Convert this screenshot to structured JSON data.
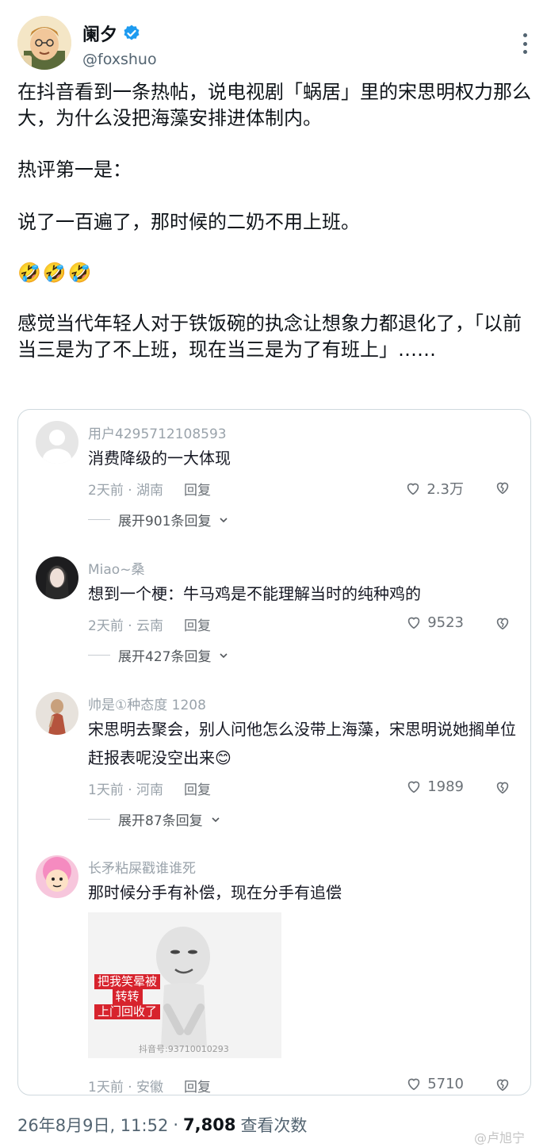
{
  "author": {
    "name": "阑夕",
    "handle": "@foxshuo",
    "verified_color": "#1d9bf0"
  },
  "post": {
    "para1": "在抖音看到一条热帖，说电视剧「蜗居」里的宋思明权力那么大，为什么没把海藻安排进体制内。",
    "para2": "热评第一是：",
    "para3": "说了一百遍了，那时候的二奶不用上班。",
    "emoji": [
      "🤣",
      "🤣",
      "🤣"
    ],
    "para5": "感觉当代年轻人对于铁饭碗的执念让想象力都退化了，「以前当三是为了不上班，现在当三是为了有班上」……"
  },
  "comments": [
    {
      "user": "用户4295712108593",
      "text": "消费降级的一大体现",
      "time_loc": "2天前 · 湖南",
      "reply": "回复",
      "likes": "2.3万",
      "expand": "展开901条回复"
    },
    {
      "user": "Miao~桑",
      "text": "想到一个梗：牛马鸡是不能理解当时的纯种鸡的",
      "time_loc": "2天前 · 云南",
      "reply": "回复",
      "likes": "9523",
      "expand": "展开427条回复"
    },
    {
      "user": "帅是①种态度 1208",
      "text": "宋思明去聚会，别人问他怎么没带上海藻，宋思明说她搁单位赶报表呢没空出来😊",
      "time_loc": "1天前 · 河南",
      "reply": "回复",
      "likes": "1989",
      "expand": "展开87条回复"
    },
    {
      "user": "长矛粘屎戳谁谁死",
      "text": "那时候分手有补偿，现在分手有追偿",
      "image_caption": "把我笑晕被转转上门回收了",
      "image_caption_lines": [
        "把我笑晕被",
        "转转",
        "上门回收了"
      ],
      "image_watermark": "抖音号:93710010293",
      "time_loc": "1天前 · 安徽",
      "reply": "回复",
      "likes": "5710"
    }
  ],
  "footer": {
    "date": "26年8月9日, 11:52",
    "dot": "·",
    "views": "7,808",
    "views_label": "查看次数",
    "watermark": "@卢旭宁"
  }
}
